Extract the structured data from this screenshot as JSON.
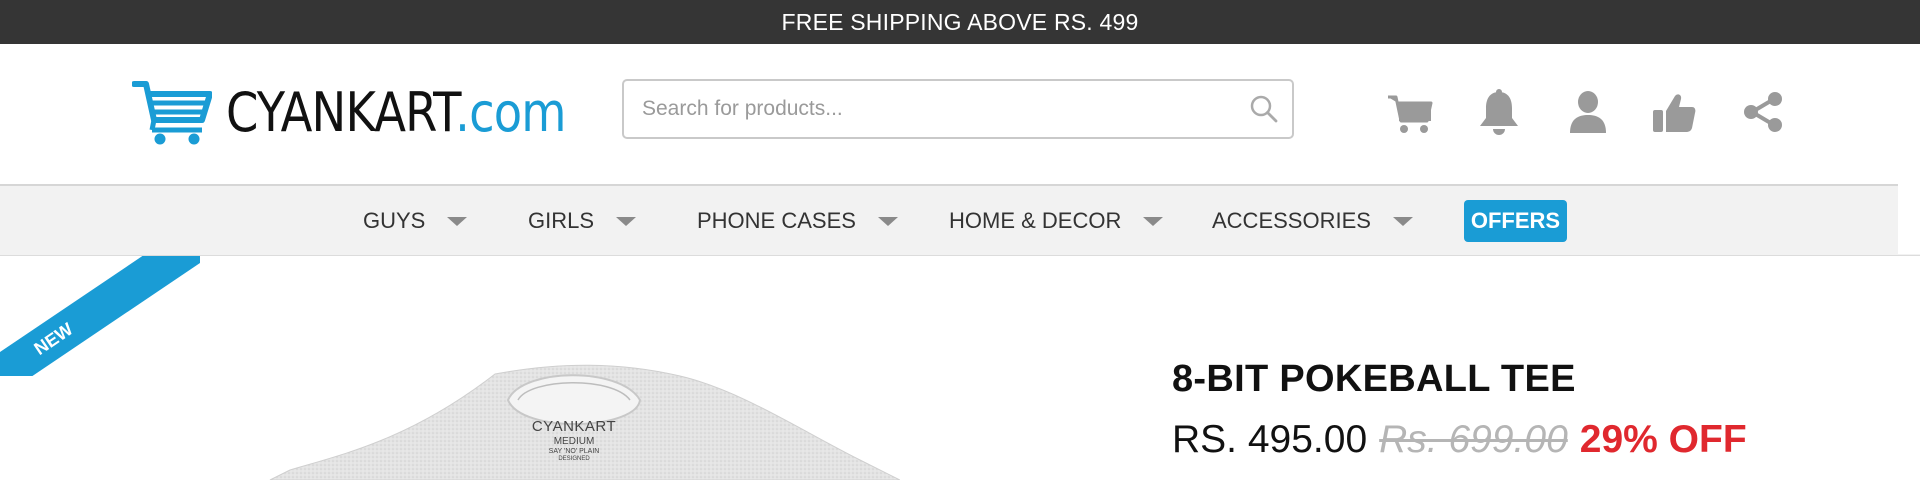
{
  "topbar": {
    "text": "FREE SHIPPING ABOVE RS. 499"
  },
  "logo": {
    "main": "CYANKART",
    "domain": ".com"
  },
  "search": {
    "placeholder": "Search for products...",
    "value": ""
  },
  "header_icons": [
    "cart-icon",
    "bell-icon",
    "user-icon",
    "thumbs-up-icon",
    "share-icon"
  ],
  "nav": {
    "items": [
      {
        "label": "GUYS"
      },
      {
        "label": "GIRLS"
      },
      {
        "label": "PHONE CASES"
      },
      {
        "label": "HOME & DECOR"
      },
      {
        "label": "ACCESSORIES"
      }
    ],
    "offers_label": "OFFERS"
  },
  "ribbon": {
    "label": "NEW"
  },
  "product": {
    "tee_label_brand": "CYANKART",
    "tee_label_size": "MEDIUM",
    "tee_label_line": "SAY 'NO' PLAIN",
    "tee_label_sub": "DESIGNED",
    "title": "8-BIT POKEBALL TEE",
    "price": "RS. 495.00",
    "old_price": "Rs. 699.00",
    "discount": "29% OFF"
  },
  "colors": {
    "brand": "#1a9cd5",
    "topbar": "#353535",
    "discount": "#e0282e",
    "icon": "#9a9a9a"
  }
}
